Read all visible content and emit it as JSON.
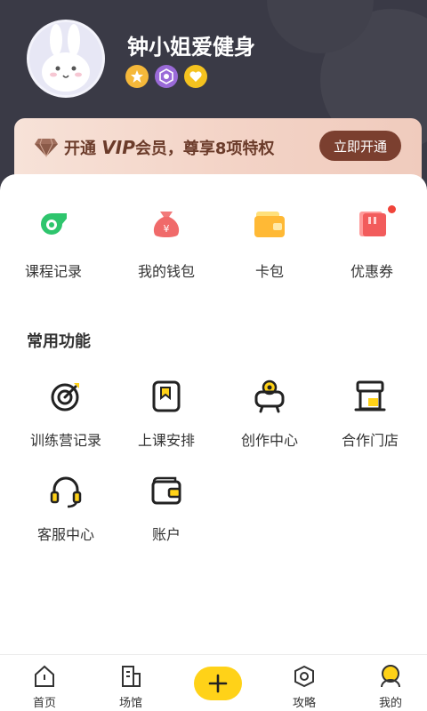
{
  "profile": {
    "username": "钟小姐爱健身"
  },
  "vip_banner": {
    "prefix": "开通",
    "vip_word": "VIP",
    "suffix": "会员，尊享8项特权",
    "button": "立即开通"
  },
  "quick_items": [
    {
      "label": "课程记录",
      "icon": "whistle-icon"
    },
    {
      "label": "我的钱包",
      "icon": "money-bag-icon"
    },
    {
      "label": "卡包",
      "icon": "card-wallet-icon"
    },
    {
      "label": "优惠券",
      "icon": "coupon-icon"
    }
  ],
  "common_functions": {
    "title": "常用功能",
    "items": [
      {
        "label": "训练营记录",
        "icon": "target-icon"
      },
      {
        "label": "上课安排",
        "icon": "schedule-icon"
      },
      {
        "label": "创作中心",
        "icon": "camera-icon"
      },
      {
        "label": "合作门店",
        "icon": "store-icon"
      },
      {
        "label": "客服中心",
        "icon": "headset-icon"
      },
      {
        "label": "账户",
        "icon": "wallet-icon"
      }
    ]
  },
  "tabbar": {
    "items": [
      {
        "label": "首页",
        "icon": "home-icon"
      },
      {
        "label": "场馆",
        "icon": "building-icon"
      },
      {
        "label": "",
        "icon": "plus-icon"
      },
      {
        "label": "攻略",
        "icon": "guide-icon"
      },
      {
        "label": "我的",
        "icon": "profile-icon"
      }
    ],
    "active": "我的"
  },
  "colors": {
    "header_bg": "#3a3a46",
    "accent_yellow": "#ffd218",
    "vip_button": "#7b3f2f",
    "notification_dot": "#f0443a"
  }
}
